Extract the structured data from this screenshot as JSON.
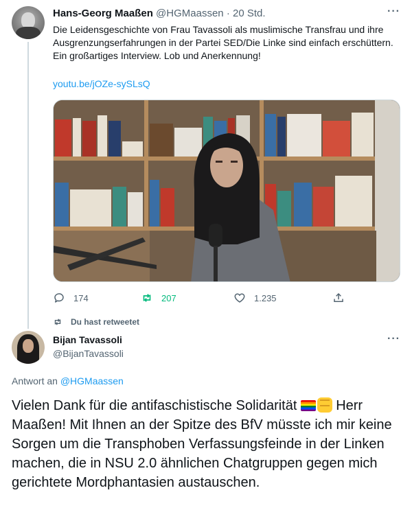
{
  "tweet1": {
    "author_name": "Hans-Georg Maaßen",
    "author_handle": "@HGMaassen",
    "timestamp": "20 Std.",
    "text": "Die Leidensgeschichte von Frau Tavassoli als muslimische Transfrau und ihre Ausgrenzungserfahrungen in der Partei SED/Die Linke sind einfach erschüttern. Ein großartiges Interview. Lob und Anerkennung!",
    "link": "youtu.be/jOZe-sySLsQ",
    "stats": {
      "replies": "174",
      "retweets": "207",
      "likes": "1.235"
    }
  },
  "retweet_note": "Du hast retweetet",
  "tweet2": {
    "author_name": "Bijan Tavassoli",
    "author_handle": "@BijanTavassoli",
    "reply_prefix": "Antwort an",
    "reply_mention": "@HGMaassen",
    "text_part1": "Vielen Dank für die antifaschistische Solidarität ",
    "text_part2": " Herr Maaßen! Mit Ihnen an der Spitze des BfV müsste ich mir keine Sorgen um die Transphoben Verfassungsfeinde in der Linken machen, die in NSU 2.0 ähnlichen Chatgruppen gegen mich gerichtete Mordphantasien austauschen."
  },
  "icons": [
    "reply-icon",
    "retweet-icon",
    "like-icon",
    "share-icon",
    "more-icon",
    "rainbow-flag-emoji",
    "raised-fist-emoji"
  ],
  "colors": {
    "link": "#1d9bf0",
    "retweet": "#00ba7c",
    "secondary": "#536471"
  }
}
